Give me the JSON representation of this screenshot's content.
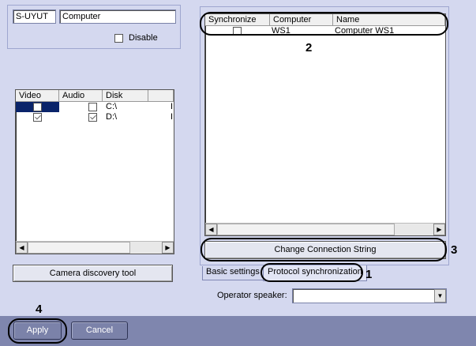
{
  "topleft": {
    "id": "S-UYUT",
    "name": "Computer",
    "disable_label": "Disable",
    "disable_checked": false
  },
  "drives": {
    "columns": [
      "Video",
      "Audio",
      "Disk"
    ],
    "rows": [
      {
        "video": false,
        "audio": false,
        "disk": "C:\\",
        "selected": true,
        "extra": "I"
      },
      {
        "video": true,
        "audio": true,
        "disk": "D:\\",
        "selected": false,
        "extra": "I"
      }
    ]
  },
  "camera_discovery_label": "Camera discovery tool",
  "sync": {
    "columns": [
      "Synchronize",
      "Computer",
      "Name"
    ],
    "rows": [
      {
        "checked": false,
        "computer": "WS1",
        "name": "Computer WS1"
      }
    ]
  },
  "change_connection_label": "Change Connection String",
  "tabs": [
    {
      "label": "Basic settings",
      "active": false
    },
    {
      "label": "Protocol synchronization",
      "active": true
    }
  ],
  "operator_speaker_label": "Operator speaker:",
  "operator_speaker_value": "",
  "footer": {
    "apply_label": "Apply",
    "cancel_label": "Cancel"
  },
  "annotations": {
    "n1": "1",
    "n2": "2",
    "n3": "3",
    "n4": "4"
  }
}
